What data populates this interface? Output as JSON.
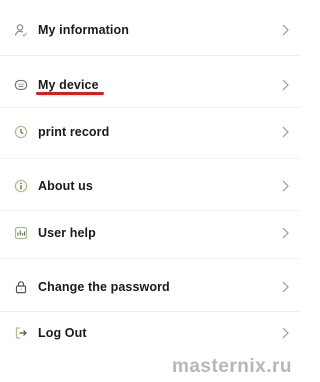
{
  "menu": {
    "items": [
      {
        "label": "My information",
        "icon": "user-icon"
      },
      {
        "label": "My device",
        "icon": "device-icon"
      },
      {
        "label": "print record",
        "icon": "clock-icon"
      },
      {
        "label": "About us",
        "icon": "info-icon"
      },
      {
        "label": "User help",
        "icon": "help-icon"
      },
      {
        "label": "Change the password",
        "icon": "lock-icon"
      },
      {
        "label": "Log Out",
        "icon": "logout-icon"
      }
    ]
  },
  "watermark": "masternix.ru",
  "colors": {
    "icon_green": "#a8c38a",
    "icon_dark": "#555555",
    "highlight_underline": "#d42020",
    "chevron": "#9a9a9a"
  }
}
